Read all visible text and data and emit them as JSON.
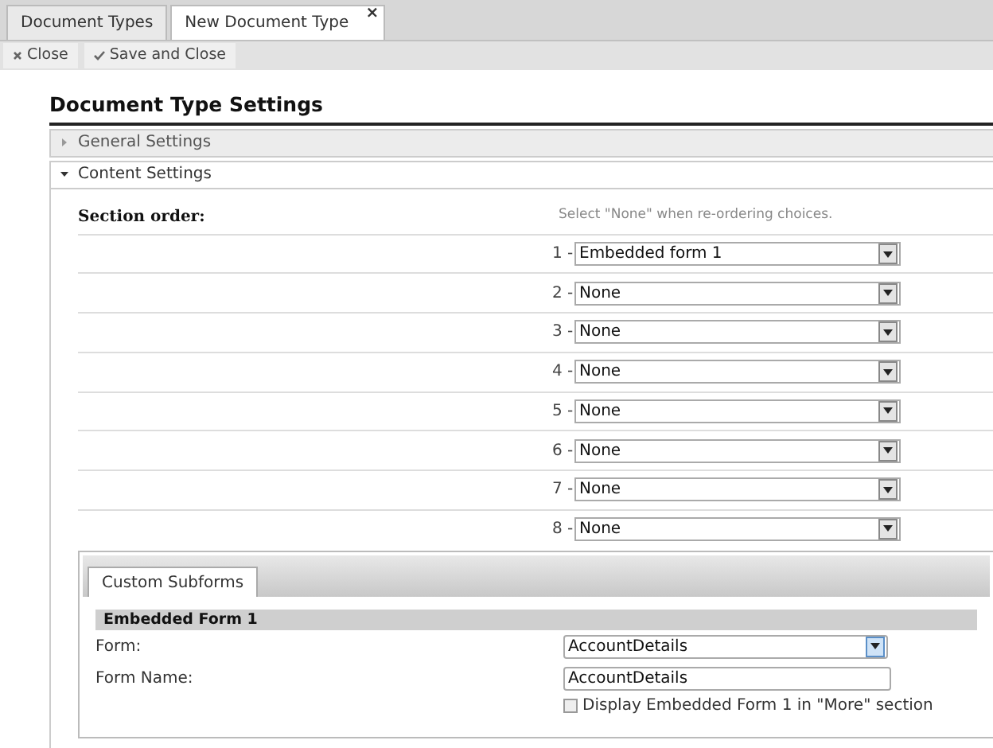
{
  "tabs": [
    {
      "label": "Document Types",
      "selected": false
    },
    {
      "label": "New Document Type",
      "selected": true,
      "close_glyph": "×"
    }
  ],
  "toolbar": [
    {
      "kind": "close",
      "label": "Close"
    },
    {
      "kind": "save",
      "label": "Save and Close"
    }
  ],
  "heading": "Document Type Settings",
  "sections": [
    {
      "title": "General Settings",
      "expanded": false
    },
    {
      "title": "Content Settings",
      "expanded": true
    }
  ],
  "section_order": {
    "label": "Section order:",
    "hint": "Select \"None\" when re-ordering choices.",
    "rows": [
      {
        "number": "1 -",
        "value": "Embedded form 1"
      },
      {
        "number": "2 -",
        "value": "None"
      },
      {
        "number": "3 -",
        "value": "None"
      },
      {
        "number": "4 -",
        "value": "None"
      },
      {
        "number": "5 -",
        "value": "None"
      },
      {
        "number": "6 -",
        "value": "None"
      },
      {
        "number": "7 -",
        "value": "None"
      },
      {
        "number": "8 -",
        "value": "None"
      }
    ]
  },
  "subforms": {
    "tabs": [
      {
        "label": "Custom Subforms",
        "selected": true
      }
    ],
    "group_title": "Embedded Form 1",
    "form_label": "Form:",
    "form_value": "AccountDetails",
    "name_label": "Form Name:",
    "name_value": "AccountDetails",
    "more_checkbox": {
      "label": "Display Embedded Form 1 in \"More\" section",
      "checked": false
    }
  }
}
